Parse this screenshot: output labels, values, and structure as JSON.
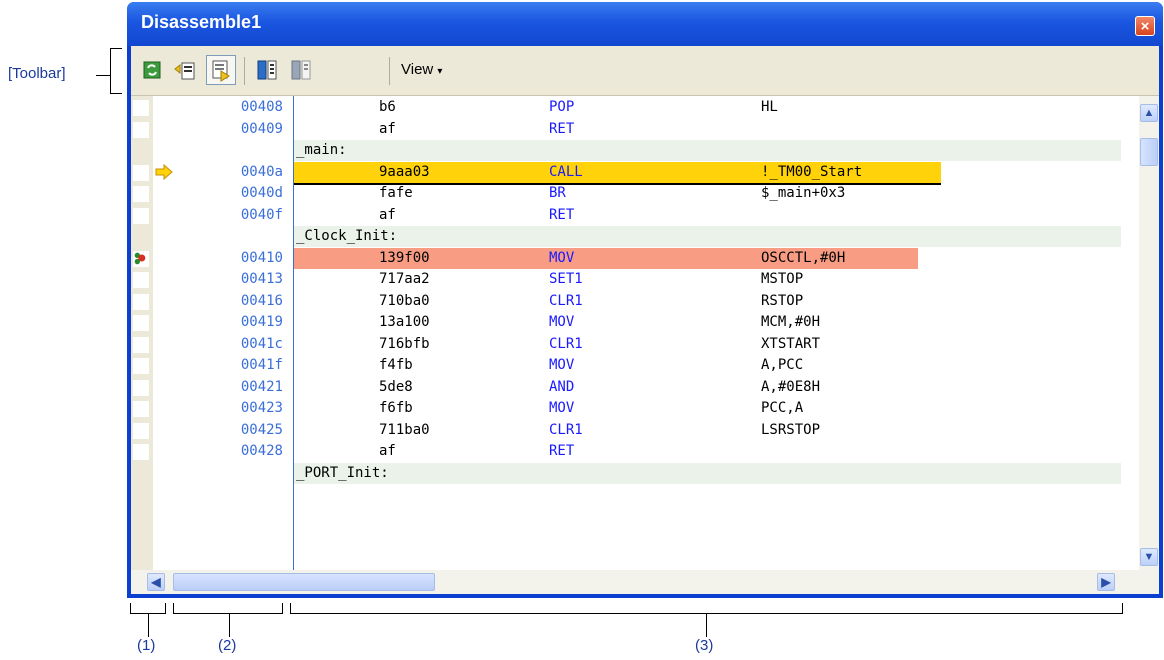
{
  "annotations": {
    "toolbar_label": "[Toolbar]",
    "area1": "(1)",
    "area2": "(2)",
    "area3": "(3)"
  },
  "window": {
    "title": "Disassemble1",
    "close_label": "×"
  },
  "toolbar": {
    "buttons": [
      {
        "name": "refresh-icon"
      },
      {
        "name": "go-to-pc-icon"
      },
      {
        "name": "display-symbol-icon"
      },
      {
        "name": "step-in-icon"
      },
      {
        "name": "step-over-icon"
      }
    ],
    "view_menu": "View"
  },
  "colors": {
    "current_pc": "#ffd20a",
    "breakpoint": "#f89c84",
    "address": "#3a6fd8",
    "mnemonic": "#1a1aff",
    "label_bg": "#eaf2ea"
  },
  "disassembly": {
    "rows": [
      {
        "kind": "code",
        "addr": "00408",
        "bytes": "b6",
        "mnem": "POP",
        "oper": "HL"
      },
      {
        "kind": "code",
        "addr": "00409",
        "bytes": "af",
        "mnem": "RET",
        "oper": ""
      },
      {
        "kind": "label",
        "text": "_main:"
      },
      {
        "kind": "code",
        "addr": "0040a",
        "bytes": "9aaa03",
        "mnem": "CALL",
        "oper": "!_TM00_Start",
        "state": "current"
      },
      {
        "kind": "code",
        "addr": "0040d",
        "bytes": "fafe",
        "mnem": "BR",
        "oper": "$_main+0x3"
      },
      {
        "kind": "code",
        "addr": "0040f",
        "bytes": "af",
        "mnem": "RET",
        "oper": ""
      },
      {
        "kind": "label",
        "text": "_Clock_Init:"
      },
      {
        "kind": "code",
        "addr": "00410",
        "bytes": "139f00",
        "mnem": "MOV",
        "oper": "OSCCTL,#0H",
        "state": "breakpoint"
      },
      {
        "kind": "code",
        "addr": "00413",
        "bytes": "717aa2",
        "mnem": "SET1",
        "oper": "MSTOP"
      },
      {
        "kind": "code",
        "addr": "00416",
        "bytes": "710ba0",
        "mnem": "CLR1",
        "oper": "RSTOP"
      },
      {
        "kind": "code",
        "addr": "00419",
        "bytes": "13a100",
        "mnem": "MOV",
        "oper": "MCM,#0H"
      },
      {
        "kind": "code",
        "addr": "0041c",
        "bytes": "716bfb",
        "mnem": "CLR1",
        "oper": "XTSTART"
      },
      {
        "kind": "code",
        "addr": "0041f",
        "bytes": "f4fb",
        "mnem": "MOV",
        "oper": "A,PCC"
      },
      {
        "kind": "code",
        "addr": "00421",
        "bytes": "5de8",
        "mnem": "AND",
        "oper": "A,#0E8H"
      },
      {
        "kind": "code",
        "addr": "00423",
        "bytes": "f6fb",
        "mnem": "MOV",
        "oper": "PCC,A"
      },
      {
        "kind": "code",
        "addr": "00425",
        "bytes": "711ba0",
        "mnem": "CLR1",
        "oper": "LSRSTOP"
      },
      {
        "kind": "code",
        "addr": "00428",
        "bytes": "af",
        "mnem": "RET",
        "oper": ""
      },
      {
        "kind": "label",
        "text": "_PORT_Init:"
      }
    ]
  }
}
